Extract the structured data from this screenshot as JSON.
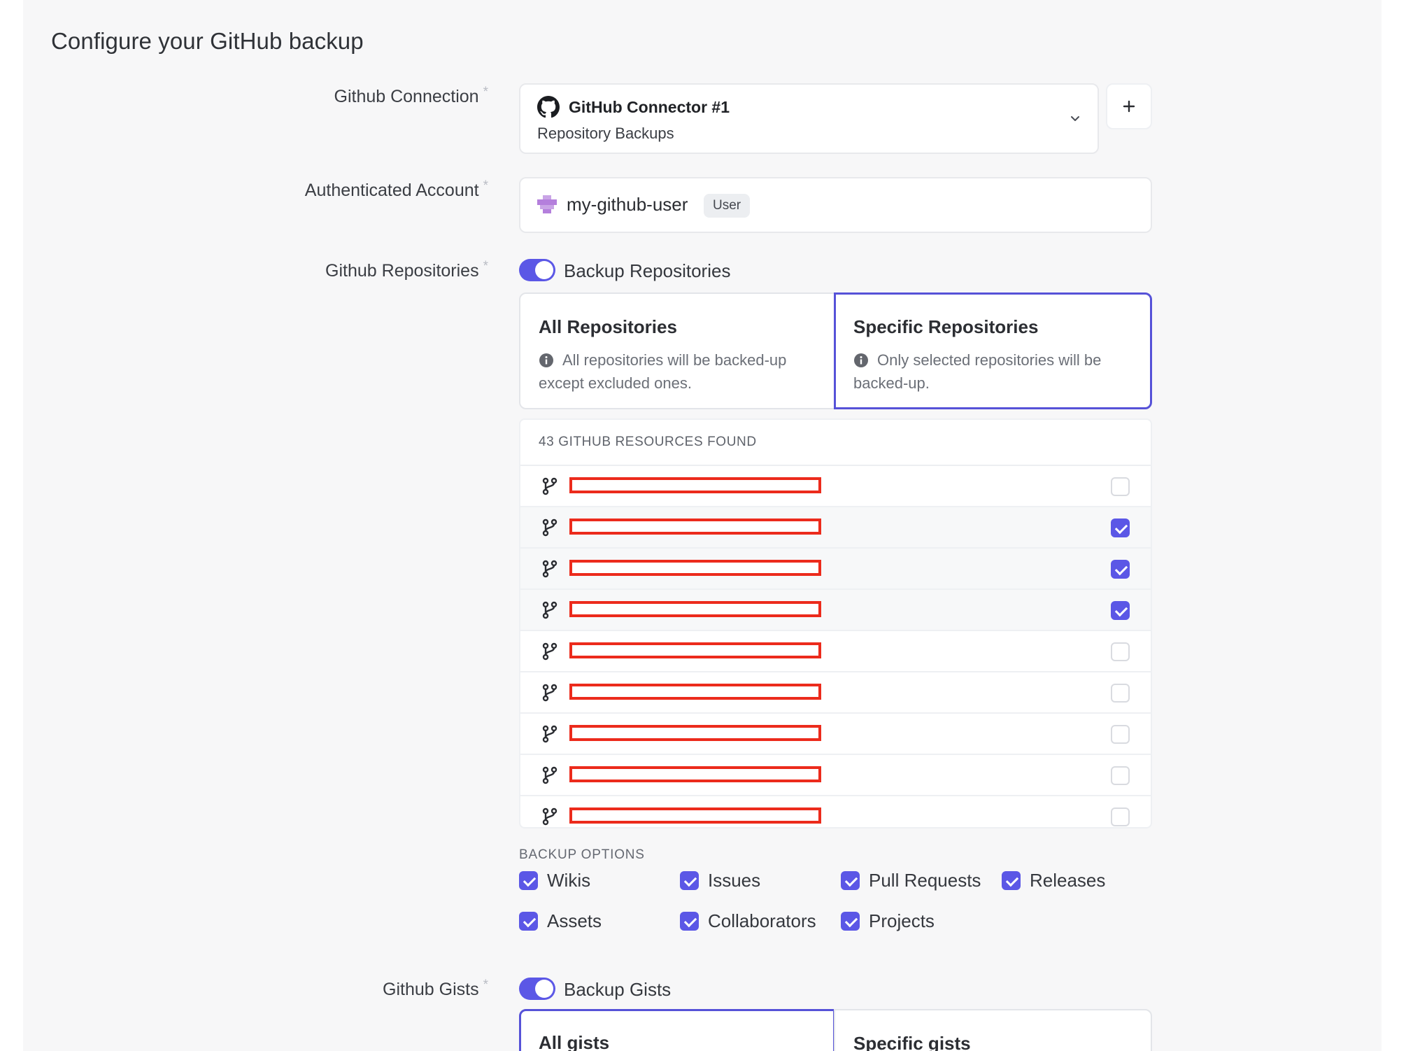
{
  "page": {
    "title": "Configure your GitHub backup"
  },
  "connection": {
    "label": "Github Connection",
    "required_mark": "*",
    "selected_name": "GitHub Connector #1",
    "selected_sub": "Repository Backups",
    "icon": "github-icon",
    "add_button_label": "+"
  },
  "account": {
    "label": "Authenticated Account",
    "required_mark": "*",
    "username": "my-github-user",
    "badge": "User"
  },
  "repositories": {
    "label": "Github Repositories",
    "required_mark": "*",
    "toggle_label": "Backup Repositories",
    "toggle_on": true,
    "modes": [
      {
        "title": "All Repositories",
        "description": "All repositories will be backed-up except excluded ones.",
        "selected": false
      },
      {
        "title": "Specific Repositories",
        "description": "Only selected repositories will be backed-up.",
        "selected": true
      }
    ],
    "found_text": "43 GITHUB RESOURCES FOUND",
    "rows": [
      {
        "name": "[redacted]",
        "checked": false
      },
      {
        "name": "[redacted]",
        "checked": true
      },
      {
        "name": "[redacted]",
        "checked": true
      },
      {
        "name": "[redacted]",
        "checked": true
      },
      {
        "name": "[redacted]",
        "checked": false
      },
      {
        "name": "[redacted]",
        "checked": false
      },
      {
        "name": "[redacted]",
        "checked": false
      },
      {
        "name": "[redacted]",
        "checked": false
      },
      {
        "name": "[redacted]",
        "checked": false
      }
    ]
  },
  "backup_options": {
    "heading": "BACKUP OPTIONS",
    "items": [
      {
        "label": "Wikis",
        "checked": true
      },
      {
        "label": "Issues",
        "checked": true
      },
      {
        "label": "Pull Requests",
        "checked": true
      },
      {
        "label": "Releases",
        "checked": true
      },
      {
        "label": "Assets",
        "checked": true
      },
      {
        "label": "Collaborators",
        "checked": true
      },
      {
        "label": "Projects",
        "checked": true
      }
    ]
  },
  "gists": {
    "label": "Github Gists",
    "required_mark": "*",
    "toggle_label": "Backup Gists",
    "toggle_on": true,
    "modes": [
      {
        "title": "All gists",
        "selected": true
      },
      {
        "title": "Specific gists",
        "selected": false
      }
    ]
  },
  "colors": {
    "accent": "#5b57e6",
    "redaction": "#ec2b1c",
    "panel": "#f7f7f8"
  }
}
